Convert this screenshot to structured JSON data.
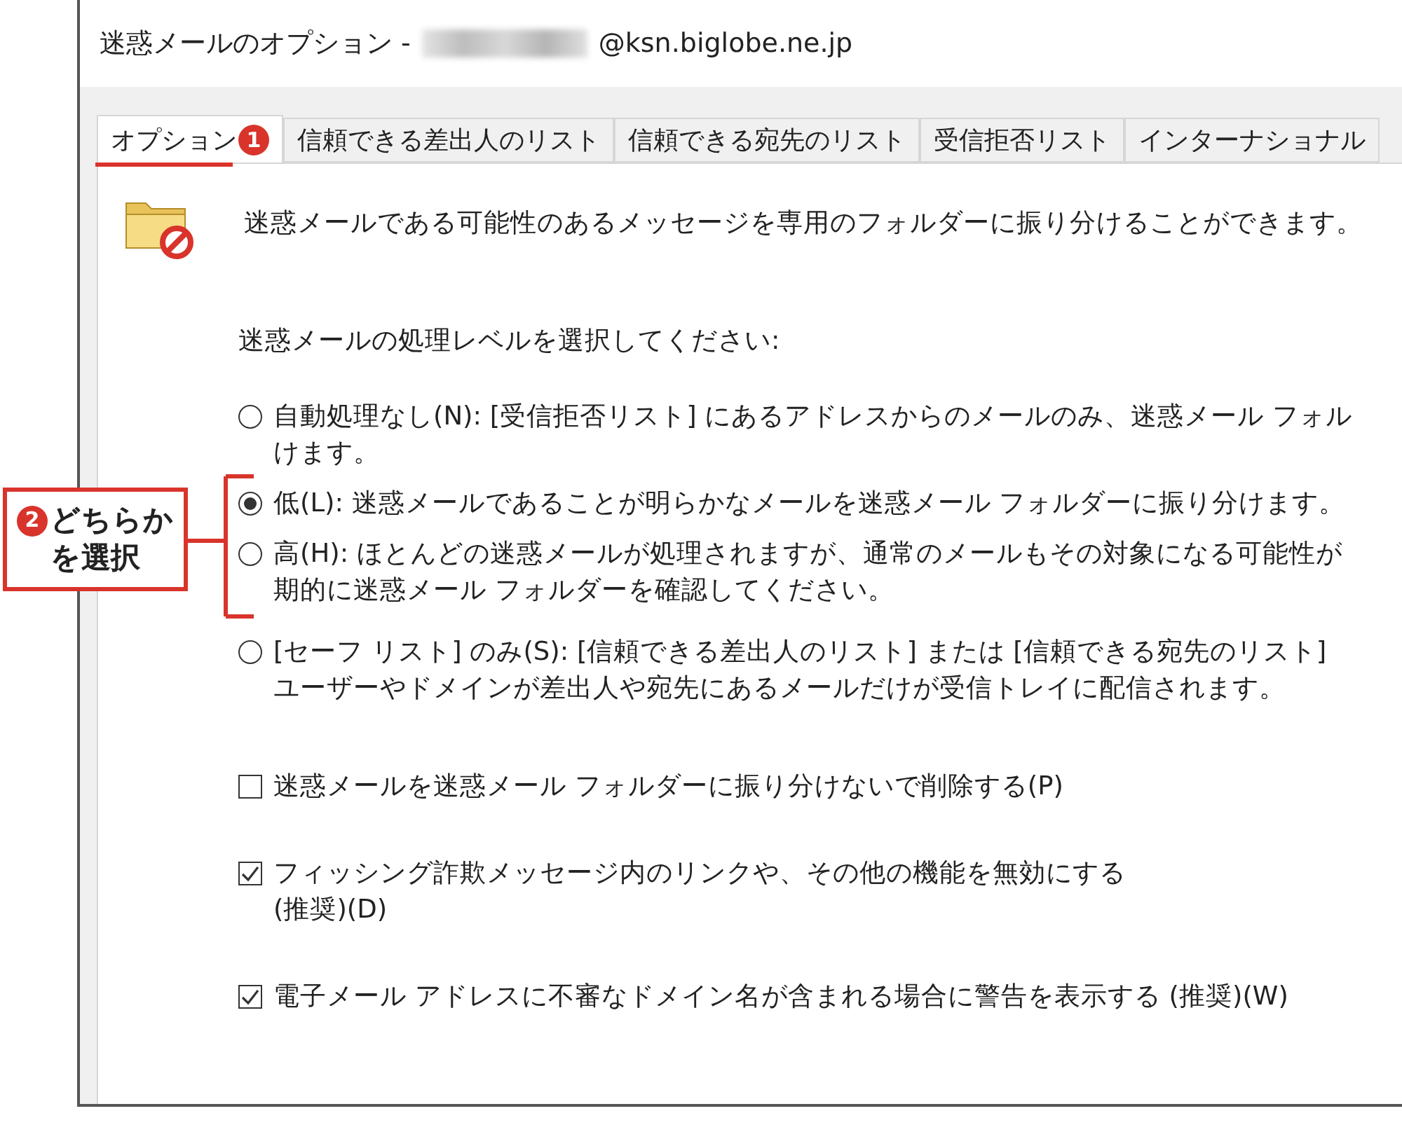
{
  "window": {
    "title": "迷惑メールのオプション -",
    "title_address": "@ksn.biglobe.ne.jp"
  },
  "tabs": [
    {
      "label": "オプション",
      "selected": true
    },
    {
      "label": "信頼できる差出人のリスト",
      "selected": false
    },
    {
      "label": "信頼できる宛先のリスト",
      "selected": false
    },
    {
      "label": "受信拒否リスト",
      "selected": false
    },
    {
      "label": "インターナショナル",
      "selected": false
    }
  ],
  "description": "迷惑メールである可能性のあるメッセージを専用のフォルダーに振り分けることができます。",
  "level_prompt": "迷惑メールの処理レベルを選択してください:",
  "options": [
    {
      "lines": [
        "自動処理なし(N): [受信拒否リスト] にあるアドレスからのメールのみ、迷惑メール フォル",
        "けます。"
      ],
      "selected": false
    },
    {
      "lines": [
        "低(L): 迷惑メールであることが明らかなメールを迷惑メール フォルダーに振り分けます。"
      ],
      "selected": true
    },
    {
      "lines": [
        "高(H): ほとんどの迷惑メールが処理されますが、通常のメールもその対象になる可能性が",
        "期的に迷惑メール フォルダーを確認してください。"
      ],
      "selected": false
    },
    {
      "lines": [
        "[セーフ リスト] のみ(S): [信頼できる差出人のリスト] または [信頼できる宛先のリスト]",
        "ユーザーやドメインが差出人や宛先にあるメールだけが受信トレイに配信されます。"
      ],
      "selected": false
    }
  ],
  "checkboxes": [
    {
      "lines": [
        "迷惑メールを迷惑メール フォルダーに振り分けないで削除する(P)"
      ],
      "checked": false
    },
    {
      "lines": [
        "フィッシング詐欺メッセージ内のリンクや、その他の機能を無効にする",
        "(推奨)(D)"
      ],
      "checked": true
    },
    {
      "lines": [
        "電子メール アドレスに不審なドメイン名が含まれる場合に警告を表示する (推奨)(W)"
      ],
      "checked": true
    }
  ],
  "annotations": [
    {
      "number": "1"
    },
    {
      "number": "2",
      "lines": [
        "どちらか",
        "を選択"
      ]
    }
  ]
}
